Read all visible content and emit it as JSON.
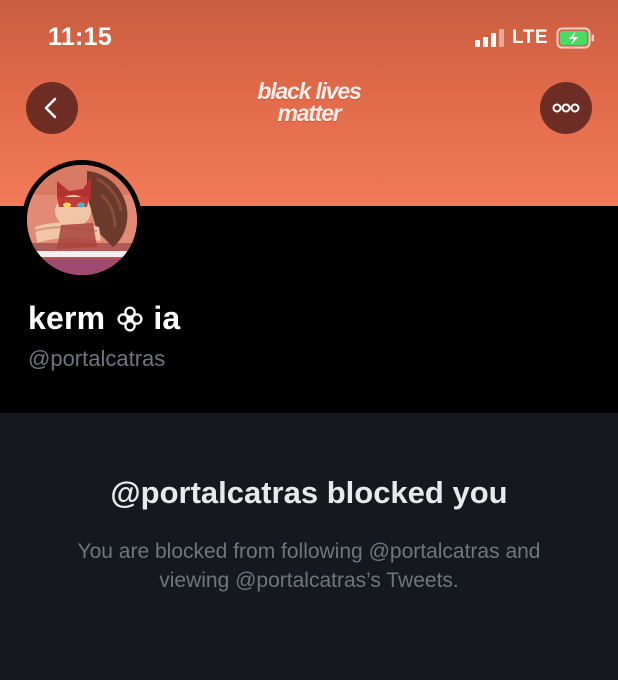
{
  "status_bar": {
    "time": "11:15",
    "network": "LTE",
    "signal_bars": 3,
    "signal_bars_total": 4,
    "battery_charging": true,
    "battery_color": "#4cd964"
  },
  "header": {
    "back_icon": "chevron-left-icon",
    "more_icon": "ellipsis-icon",
    "banner_text_line1": "black lives",
    "banner_text_line2": "matter",
    "banner_colors": [
      "#c95e41",
      "#f27a58"
    ]
  },
  "profile": {
    "name_prefix": "kerm",
    "name_suffix": "ia",
    "name_emoji_icon": "flower-icon",
    "handle": "@portalcatras"
  },
  "blocked": {
    "title": "@portalcatras blocked you",
    "message": "You are blocked from following @portalcatras and viewing @portalcatras’s Tweets."
  },
  "colors": {
    "background": "#000000",
    "panel": "#15181c",
    "secondary_text": "#6e767d",
    "header_button": "#6e2d24"
  }
}
